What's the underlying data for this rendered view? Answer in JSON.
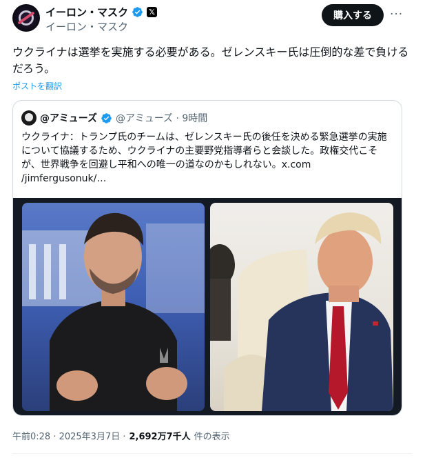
{
  "author": {
    "display_name": "イーロン・マスク",
    "handle": "イーロン・マスク",
    "avatar_icon": "galaxy-avatar",
    "verified_color": "#1d9bf0",
    "affiliate_badge": "𝕏"
  },
  "actions": {
    "buy_label": "購入する",
    "more_label": "···"
  },
  "tweet": {
    "text": "ウクライナは選挙を実施する必要がある。ゼレンスキー氏は圧倒的な差で負けるだろう。",
    "translate_label": "ポストを翻訳"
  },
  "quote": {
    "name": "@アミューズ",
    "meta": "@アミューズ · 9時間",
    "text": "ウクライナ：トランプ氏のチームは、ゼレンスキー氏の後任を決める緊急選挙の実施について協議するため、ウクライナの主要野党指導者らと会談した。政権交代こそが、世界戦争を回避し平和への唯一の道なのかもしれない。x.com /jimfergusonuk/…"
  },
  "footer": {
    "timestamp": "午前0:28 · 2025年3月7日 ·",
    "views_count": "2,692万7千人",
    "views_label": "件の表示"
  }
}
